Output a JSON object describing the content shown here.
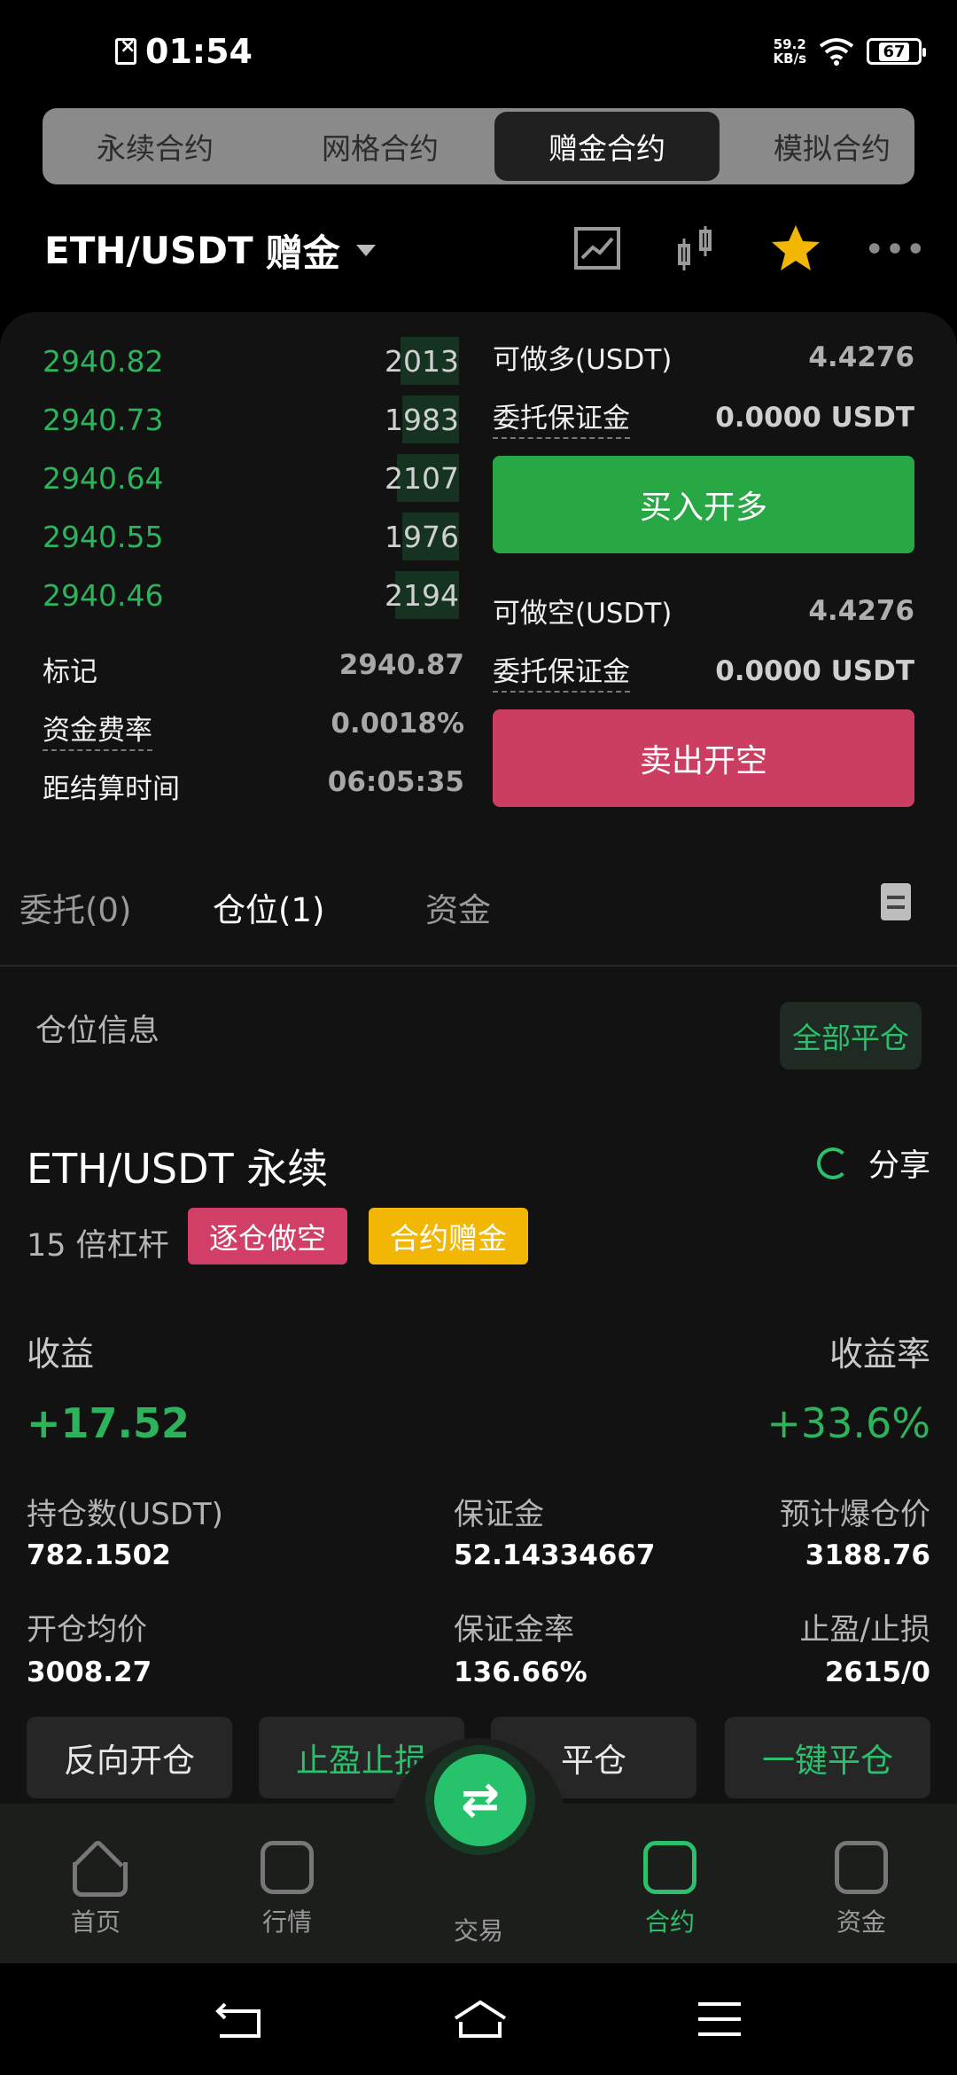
{
  "status": {
    "time": "01:54",
    "net_speed": "59.2",
    "net_unit": "KB/s",
    "battery": "67"
  },
  "seg_tabs": [
    "永续合约",
    "网格合约",
    "赠金合约",
    "模拟合约"
  ],
  "pair": {
    "symbol": "ETH/USDT",
    "mode": "赠金"
  },
  "orderbook": [
    {
      "price": "2940.82",
      "qty": "2013"
    },
    {
      "price": "2940.73",
      "qty": "1983"
    },
    {
      "price": "2940.64",
      "qty": "2107"
    },
    {
      "price": "2940.55",
      "qty": "1976"
    },
    {
      "price": "2940.46",
      "qty": "2194"
    }
  ],
  "market": {
    "mark_label": "标记",
    "mark_value": "2940.87",
    "funding_label": "资金费率",
    "funding_value": "0.0018%",
    "settle_label": "距结算时间",
    "settle_value": "06:05:35"
  },
  "long": {
    "avail_label": "可做多(USDT)",
    "avail_value": "4.4276",
    "margin_label": "委托保证金",
    "margin_value": "0.0000 USDT",
    "button": "买入开多"
  },
  "short": {
    "avail_label": "可做空(USDT)",
    "avail_value": "4.4276",
    "margin_label": "委托保证金",
    "margin_value": "0.0000 USDT",
    "button": "卖出开空"
  },
  "pos_tabs": [
    "委托(0)",
    "仓位(1)",
    "资金"
  ],
  "position": {
    "section_label": "仓位信息",
    "close_all": "全部平仓",
    "title": "ETH/USDT 永续",
    "share": "分享",
    "leverage": "15 倍杠杆",
    "tag_side": "逐仓做空",
    "tag_bonus": "合约赠金",
    "pnl_label": "收益",
    "pnl_value": "+17.52",
    "roe_label": "收益率",
    "roe_value": "+33.6%",
    "size_label": "持仓数(USDT)",
    "size_value": "782.1502",
    "margin_label": "保证金",
    "margin_value": "52.14334667",
    "liq_label": "预计爆仓价",
    "liq_value": "3188.76",
    "entry_label": "开仓均价",
    "entry_value": "3008.27",
    "margin_rate_label": "保证金率",
    "margin_rate_value": "136.66%",
    "tpsl_label": "止盈/止损",
    "tpsl_value": "2615/0"
  },
  "actions": [
    "反向开仓",
    "止盈止损",
    "平仓",
    "一键平仓"
  ],
  "nav": [
    "首页",
    "行情",
    "交易",
    "合约",
    "资金"
  ]
}
